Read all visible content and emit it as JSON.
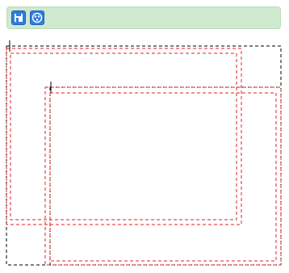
{
  "toolbar": {
    "buttons": [
      {
        "icon": "save-icon"
      },
      {
        "icon": "palette-icon"
      }
    ],
    "background_color": "#cfe9cf",
    "button_color": "#2f7de1"
  },
  "canvas": {
    "outline_color_black": "#000000",
    "outline_color_red": "#e0202a"
  }
}
